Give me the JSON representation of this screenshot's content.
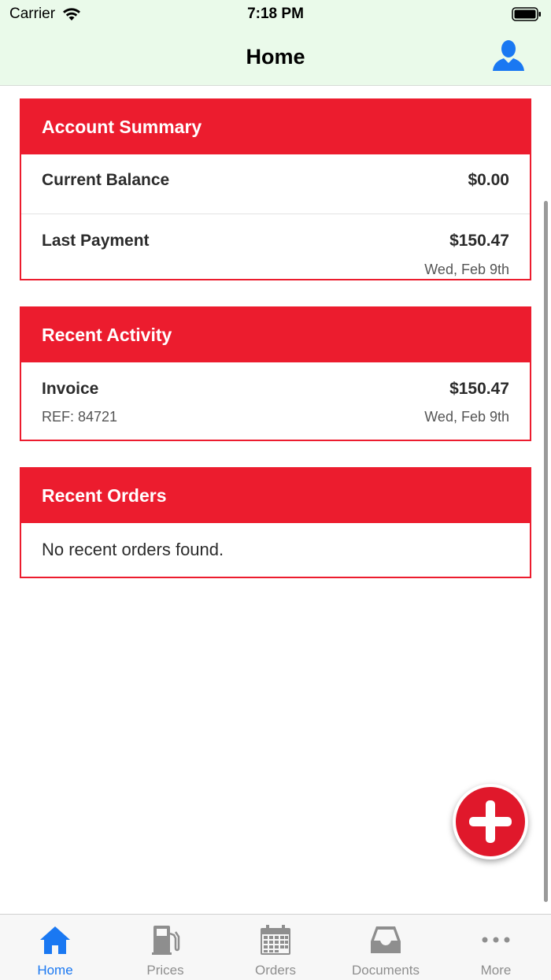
{
  "status_bar": {
    "carrier": "Carrier",
    "time": "7:18 PM"
  },
  "nav": {
    "title": "Home",
    "profile_icon": "person-icon"
  },
  "account_summary": {
    "title": "Account Summary",
    "current_balance_label": "Current Balance",
    "current_balance_value": "$0.00",
    "last_payment_label": "Last Payment",
    "last_payment_value": "$150.47",
    "last_payment_date": "Wed, Feb 9th"
  },
  "recent_activity": {
    "title": "Recent Activity",
    "items": [
      {
        "label": "Invoice",
        "amount": "$150.47",
        "ref": "REF: 84721",
        "date": "Wed, Feb 9th"
      }
    ]
  },
  "recent_orders": {
    "title": "Recent Orders",
    "empty_message": "No recent orders found."
  },
  "fab": {
    "icon": "plus-icon"
  },
  "tabs": [
    {
      "label": "Home",
      "icon": "house-icon",
      "active": true
    },
    {
      "label": "Prices",
      "icon": "fuel-pump-icon",
      "active": false
    },
    {
      "label": "Orders",
      "icon": "calendar-icon",
      "active": false
    },
    {
      "label": "Documents",
      "icon": "inbox-tray-icon",
      "active": false
    },
    {
      "label": "More",
      "icon": "ellipsis-icon",
      "active": false
    }
  ],
  "colors": {
    "brand_red": "#ec1c2e",
    "nav_background": "#eafaea",
    "active_tab": "#1a78f2",
    "inactive_tab": "#8e8e8e"
  }
}
